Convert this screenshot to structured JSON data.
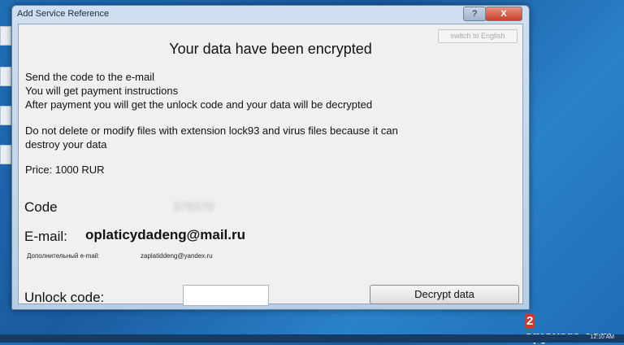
{
  "window": {
    "title": "Add Service Reference",
    "help_label": "?",
    "close_label": "X"
  },
  "ransom": {
    "switch_label": "switch to English",
    "headline": "Your data have been encrypted",
    "lines": [
      "Send the code to the e-mail",
      "You will get payment instructions",
      "After payment you will get the unlock code and your data will be decrypted"
    ],
    "warning_lines": [
      "Do not delete or modify files with extension lock93 and virus files because it can",
      "destroy your data"
    ],
    "price": "Price: 1000 RUR",
    "code_label": "Code",
    "code_value": "378370",
    "email_label": "E-mail:",
    "email_value": "oplaticydadeng@mail.ru",
    "alt_email_label": "Дополнительный e-mail:",
    "alt_email_value": "zaplatiddeng@yandex.ru",
    "unlock_label": "Unlock code:",
    "unlock_value": "",
    "decrypt_label": "Decrypt data"
  },
  "taskbar": {
    "clock": "12:10 AM"
  },
  "watermark": {
    "badge": "2",
    "text": "spyware.com"
  }
}
